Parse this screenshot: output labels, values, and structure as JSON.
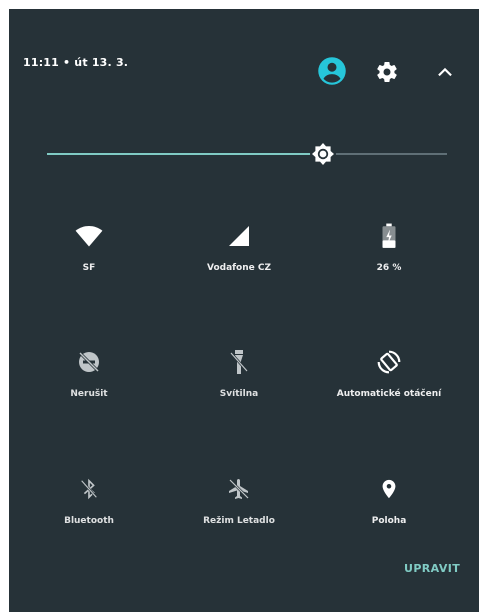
{
  "status": {
    "time_date": "11:11 • út 13. 3."
  },
  "header": {
    "user_icon": "account-circle-icon",
    "settings_icon": "gear-icon",
    "collapse_icon": "chevron-up-icon"
  },
  "brightness": {
    "level": 0.69,
    "icon": "brightness-icon"
  },
  "colors": {
    "panel": "#263238",
    "accent": "#80cbc4",
    "user": "#26c6da"
  },
  "tiles": [
    {
      "label": "SF",
      "icon": "wifi-icon",
      "active": true
    },
    {
      "label": "Vodafone CZ",
      "icon": "cellular-signal-icon",
      "active": true
    },
    {
      "label": "26 %",
      "icon": "battery-charging-icon",
      "active": true
    },
    {
      "label": "Nerušit",
      "icon": "do-not-disturb-icon",
      "active": false
    },
    {
      "label": "Svítilna",
      "icon": "flashlight-off-icon",
      "active": false
    },
    {
      "label": "Automatické otáčení",
      "icon": "auto-rotate-icon",
      "active": true
    },
    {
      "label": "Bluetooth",
      "icon": "bluetooth-off-icon",
      "active": false
    },
    {
      "label": "Režim Letadlo",
      "icon": "airplane-mode-off-icon",
      "active": false
    },
    {
      "label": "Poloha",
      "icon": "location-icon",
      "active": true
    }
  ],
  "edit_label": "UPRAVIT"
}
